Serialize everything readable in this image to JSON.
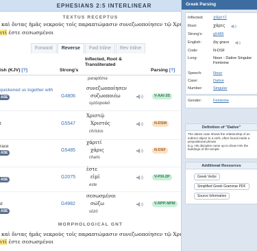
{
  "header": {
    "title": "EPHESIANS 2:5 INTERLINEAR"
  },
  "textus_receptus": {
    "label": "TEXTUS RECEPTUS",
    "line1_before": "καὶ ὄντας ἡμᾶς νεκροὺς τοῖς παραπτώμασιν συνεζωοποίησεν τῷ Χριστῷ",
    "line2_highlight": "ιτί",
    "line2_after": " ἐστε σεσωσμένοι"
  },
  "tabs": [
    {
      "label": "Forward",
      "active": false
    },
    {
      "label": "Reverse",
      "active": true
    },
    {
      "label": "Fwd Inline",
      "active": false
    },
    {
      "label": "Rev Inline",
      "active": false
    }
  ],
  "table": {
    "headers": {
      "kjv": "ish (KJV)",
      "kjv_help": "[?]",
      "strongs": "Strong's",
      "inflected": "Inflected, Root & Transliterated",
      "parsing": "Parsing",
      "parsing_help": "[?]"
    },
    "prev_translit": "paraptōma",
    "rows": [
      {
        "english": "quickened us together with",
        "english_blue": true,
        "pill": "ASE",
        "strongs": "G4806",
        "inflected": "συνεζωοποίησεν",
        "root": "συζωοποιέω",
        "translit": "syzōopoieō",
        "parsing": "V-AAI-3S",
        "color": "green"
      },
      {
        "english": "t",
        "english_blue": false,
        "pill": "",
        "strongs": "G5547",
        "inflected": "Χριστῷ",
        "root": "Χριστός",
        "translit": "christos",
        "parsing": "N-DSM",
        "color": "orange"
      },
      {
        "english": "race",
        "english_blue": false,
        "pill": "ASE",
        "strongs": "G5485",
        "inflected": "χάριτί",
        "root": "χάρις",
        "translit": "charis",
        "parsing": "N-DSF",
        "color": "orange"
      },
      {
        "english": "",
        "english_blue": false,
        "pill": "ASE",
        "strongs": "G2075",
        "inflected": "ἐστε",
        "root": "εἰμί",
        "translit": "este",
        "parsing": "V-PXI-2P",
        "color": "green"
      },
      {
        "english": "d",
        "english_blue": false,
        "pill": "ASE",
        "strongs": "G4982",
        "inflected": "σεσωσμένοι",
        "root": "σώζω",
        "translit": "sōzō",
        "parsing": "V-RPP-NPM",
        "color": "green"
      }
    ]
  },
  "morphological": {
    "label": "MORPHOLOGICAL GNT",
    "line1": "καὶ ὄντας ἡμᾶς νεκροὺς τοῖς παραπτώμασιν συνεζωοποίησεν τῷ Χριστῷ",
    "line2_highlight": "ιτί",
    "line2_after": " ἐστε σεσωσμένοι"
  },
  "side": {
    "title": "Greek Parsing",
    "fields": {
      "inflected_label": "Inflected:",
      "inflected_value": "χάριτί",
      "root_label": "Root:",
      "root_value": "χάρις",
      "strongs_label": "Strong's:",
      "strongs_value": "g5485",
      "english_label": "English:",
      "english_value": "(by grace",
      "code_label": "Code:",
      "code_value": "N-DSF",
      "long_label": "Long:",
      "long_value": "Noun - Dative Singular Feminine",
      "speech_label": "Speech:",
      "speech_value": "Noun",
      "case_label": "Case:",
      "case_value": "Dative",
      "number_label": "Number:",
      "number_value": "Singular",
      "gender_label": "Gender:",
      "gender_value": "Feminine"
    },
    "definition": {
      "title": "Definition of \"Dative\"",
      "body": "The dative case shows the relationship of an indirect object to a verb, often found inside a prepositional phrase",
      "example": "E.g. His disciples came up to show Him the buildings of the temple"
    },
    "resources": {
      "title": "Additional Resources",
      "buttons": [
        "Greek Verbs",
        "Simplified Greek Grammar PDF",
        "Source Information"
      ]
    }
  }
}
